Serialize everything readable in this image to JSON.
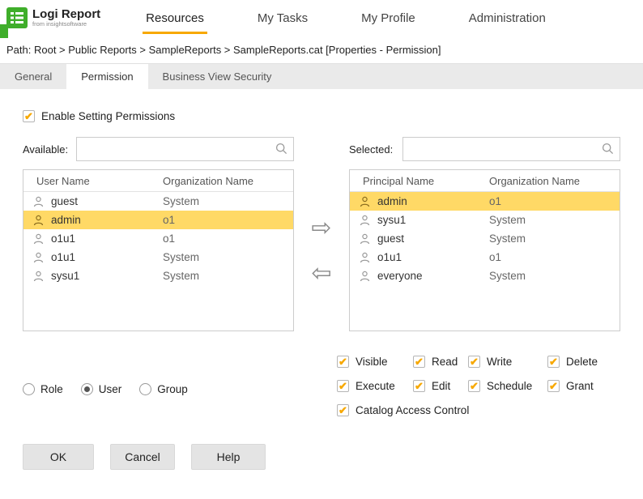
{
  "colors": {
    "accent": "#F7A800",
    "row_highlight": "#FFD966",
    "brand_green": "#3FAE2A"
  },
  "header": {
    "logo": {
      "line1": "Logi Report",
      "line2": "from insightsoftware"
    },
    "nav": [
      {
        "label": "Resources",
        "active": true
      },
      {
        "label": "My Tasks",
        "active": false
      },
      {
        "label": "My Profile",
        "active": false
      },
      {
        "label": "Administration",
        "active": false
      }
    ]
  },
  "breadcrumb": "Path: Root > Public Reports > SampleReports > SampleReports.cat [Properties - Permission]",
  "tabs": [
    {
      "label": "General",
      "active": false
    },
    {
      "label": "Permission",
      "active": true
    },
    {
      "label": "Business View Security",
      "active": false
    }
  ],
  "enable_permissions": {
    "label": "Enable Setting Permissions",
    "checked": true
  },
  "available": {
    "label": "Available:",
    "search_value": "",
    "columns": [
      "User Name",
      "Organization Name"
    ],
    "rows": [
      {
        "name": "guest",
        "org": "System",
        "highlighted": false
      },
      {
        "name": "admin",
        "org": "o1",
        "highlighted": true
      },
      {
        "name": "o1u1",
        "org": "o1",
        "highlighted": false
      },
      {
        "name": "o1u1",
        "org": "System",
        "highlighted": false
      },
      {
        "name": "sysu1",
        "org": "System",
        "highlighted": false
      }
    ]
  },
  "selected": {
    "label": "Selected:",
    "search_value": "",
    "columns": [
      "Principal Name",
      "Organization Name"
    ],
    "rows": [
      {
        "name": "admin",
        "org": "o1",
        "highlighted": true
      },
      {
        "name": "sysu1",
        "org": "System",
        "highlighted": false
      },
      {
        "name": "guest",
        "org": "System",
        "highlighted": false
      },
      {
        "name": "o1u1",
        "org": "o1",
        "highlighted": false
      },
      {
        "name": "everyone",
        "org": "System",
        "highlighted": false
      }
    ]
  },
  "transfer": {
    "to_selected_icon": "⇨",
    "to_available_icon": "⇦"
  },
  "principal_types": [
    {
      "label": "Role",
      "selected": false
    },
    {
      "label": "User",
      "selected": true
    },
    {
      "label": "Group",
      "selected": false
    }
  ],
  "permissions": {
    "items": [
      {
        "label": "Visible",
        "checked": true
      },
      {
        "label": "Read",
        "checked": true
      },
      {
        "label": "Write",
        "checked": true
      },
      {
        "label": "Delete",
        "checked": true
      },
      {
        "label": "Execute",
        "checked": true
      },
      {
        "label": "Edit",
        "checked": true
      },
      {
        "label": "Schedule",
        "checked": true
      },
      {
        "label": "Grant",
        "checked": true
      },
      {
        "label": "Catalog Access Control",
        "checked": true
      }
    ]
  },
  "footer_buttons": [
    {
      "label": "OK"
    },
    {
      "label": "Cancel"
    },
    {
      "label": "Help"
    }
  ]
}
